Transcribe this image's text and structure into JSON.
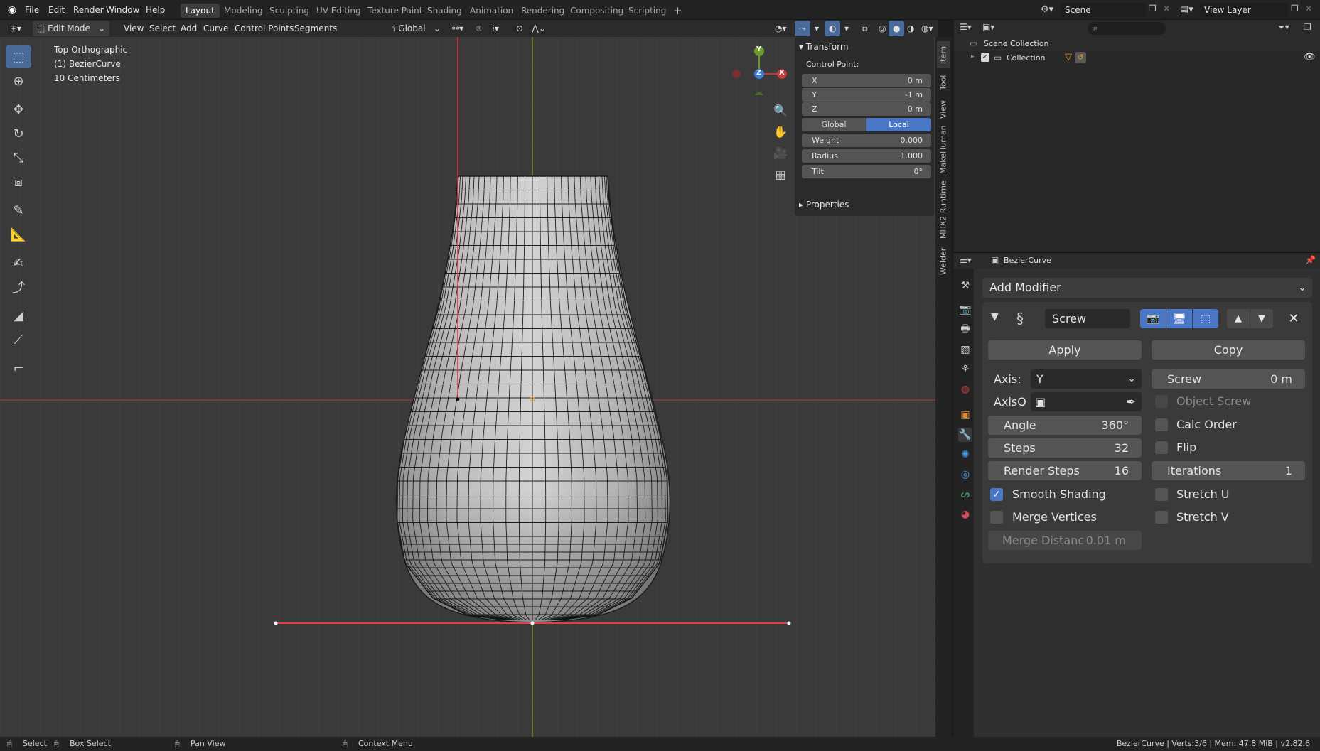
{
  "menu": {
    "items": [
      "File",
      "Edit",
      "Render",
      "Window",
      "Help"
    ]
  },
  "workspaces": {
    "tabs": [
      "Layout",
      "Modeling",
      "Sculpting",
      "UV Editing",
      "Texture Paint",
      "Shading",
      "Animation",
      "Rendering",
      "Compositing",
      "Scripting"
    ],
    "active": "Layout",
    "add_label": "+"
  },
  "scene": {
    "name": "Scene",
    "view_layer": "View Layer"
  },
  "viewport_header": {
    "mode": "Edit Mode",
    "menus": [
      "View",
      "Select",
      "Add",
      "Curve",
      "Control Points",
      "Segments"
    ],
    "orientation": "Global"
  },
  "viewport_overlay": {
    "view_name": "Top Orthographic",
    "object": "(1) BezierCurve",
    "scale": "10 Centimeters"
  },
  "gizmo": {
    "y": "Y",
    "z": "Z",
    "x": "X"
  },
  "n_panel": {
    "transform_title": "Transform",
    "control_point_label": "Control Point:",
    "x_label": "X",
    "x_value": "0 m",
    "y_label": "Y",
    "y_value": "-1 m",
    "z_label": "Z",
    "z_value": "0 m",
    "global_label": "Global",
    "local_label": "Local",
    "weight_label": "Weight",
    "weight_value": "0.000",
    "radius_label": "Radius",
    "radius_value": "1.000",
    "tilt_label": "Tilt",
    "tilt_value": "0°",
    "properties_title": "Properties",
    "tabs": [
      "Item",
      "Tool",
      "View",
      "MakeHuman",
      "MHX2 Runtime",
      "Welder"
    ]
  },
  "outliner": {
    "scene_collection": "Scene Collection",
    "collection": "Collection"
  },
  "properties_editor": {
    "object_name": "BezierCurve",
    "add_modifier_label": "Add Modifier",
    "modifier": {
      "name": "Screw",
      "apply_label": "Apply",
      "copy_label": "Copy",
      "axis_label": "Axis:",
      "axis_value": "Y",
      "screw_label": "Screw",
      "screw_value": "0 m",
      "axis_object_label": "AxisO",
      "object_screw_label": "Object Screw",
      "angle_label": "Angle",
      "angle_value": "360°",
      "calc_order_label": "Calc Order",
      "steps_label": "Steps",
      "steps_value": "32",
      "flip_label": "Flip",
      "render_steps_label": "Render Steps",
      "render_steps_value": "16",
      "iterations_label": "Iterations",
      "iterations_value": "1",
      "smooth_shading_label": "Smooth Shading",
      "smooth_shading_checked": true,
      "stretch_u_label": "Stretch U",
      "merge_vertices_label": "Merge Vertices",
      "stretch_v_label": "Stretch V",
      "merge_distance_label": "Merge Distanc",
      "merge_distance_value": "0.01 m"
    }
  },
  "status_bar": {
    "select_label": "Select",
    "box_select_label": "Box Select",
    "pan_view_label": "Pan View",
    "context_menu_label": "Context Menu",
    "stats": "BezierCurve | Verts:3/6 | Mem: 47.8 MiB | v2.82.6"
  },
  "colors": {
    "accent": "#4a76c6",
    "x_axis": "#c23b3b",
    "y_axis": "#6c9a2c",
    "z_axis": "#3a7bd5",
    "viewport_bg": "#3a3a3a"
  }
}
